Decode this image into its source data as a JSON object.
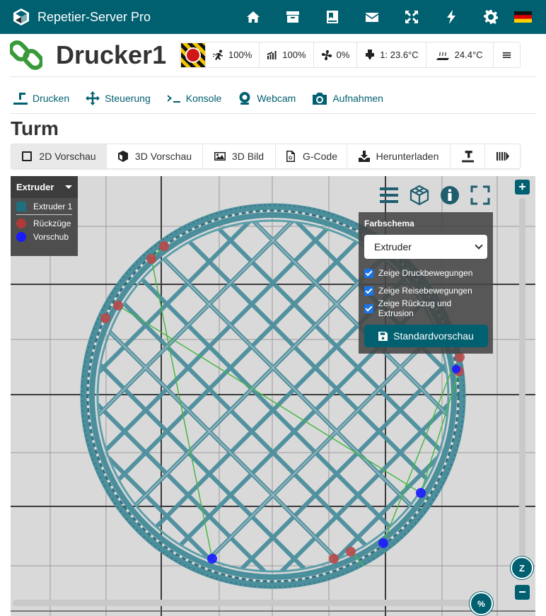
{
  "app": {
    "title": "Repetier-Server Pro"
  },
  "top_nav": {
    "icons": [
      "home-icon",
      "archive-icon",
      "book-icon",
      "mail-icon",
      "fullscreen-icon",
      "bolt-icon",
      "gear-icon"
    ],
    "flag": "german-flag-icon"
  },
  "printer": {
    "name": "Drucker1",
    "status": {
      "speed": "100%",
      "flow": "100%",
      "fan": "0%",
      "extruder_temp": "1: 23.6°C",
      "bed_temp": "24.4°C"
    }
  },
  "nav": {
    "items": [
      {
        "label": "Drucken",
        "icon": "print-icon"
      },
      {
        "label": "Steuerung",
        "icon": "move-icon"
      },
      {
        "label": "Konsole",
        "icon": "terminal-icon"
      },
      {
        "label": "Webcam",
        "icon": "webcam-icon"
      },
      {
        "label": "Aufnahmen",
        "icon": "camera-icon"
      }
    ]
  },
  "page": {
    "title": "Turm"
  },
  "tabs": [
    {
      "label": "2D Vorschau",
      "icon": "square-icon",
      "active": true
    },
    {
      "label": "3D Vorschau",
      "icon": "cube-icon",
      "active": false
    },
    {
      "label": "3D Bild",
      "icon": "image-icon",
      "active": false
    },
    {
      "label": "G-Code",
      "icon": "gcode-file-icon",
      "active": false
    },
    {
      "label": "Herunterladen",
      "icon": "download-icon",
      "active": false
    },
    {
      "label": "",
      "icon": "print-icon",
      "active": false
    },
    {
      "label": "",
      "icon": "queue-icon",
      "active": false
    }
  ],
  "legend": {
    "header": "Extruder",
    "items": [
      {
        "label": "Extruder 1",
        "color": "#1f6f7f"
      },
      {
        "label": "Rückzüge",
        "color": "#b03a3a"
      },
      {
        "label": "Vorschub",
        "color": "#1a1aff"
      }
    ]
  },
  "options": {
    "title": "Farbschema",
    "scheme_value": "Extruder",
    "checkboxes": [
      {
        "label": "Zeige Druckbewegungen",
        "checked": true
      },
      {
        "label": "Zeige Reisebewegungen",
        "checked": true
      },
      {
        "label": "Zeige Rückzug und Extrusion",
        "checked": true
      }
    ],
    "default_view_button": "Standardvorschau"
  },
  "viewer": {
    "z_label": "Z",
    "percent_label": "%",
    "zoom_in": "+",
    "zoom_out": "−"
  },
  "colors": {
    "accent": "#006070",
    "print_path": "#4b8e9c",
    "travel": "#45b845",
    "retract": "#b84a4a",
    "feed": "#1a1aff"
  }
}
